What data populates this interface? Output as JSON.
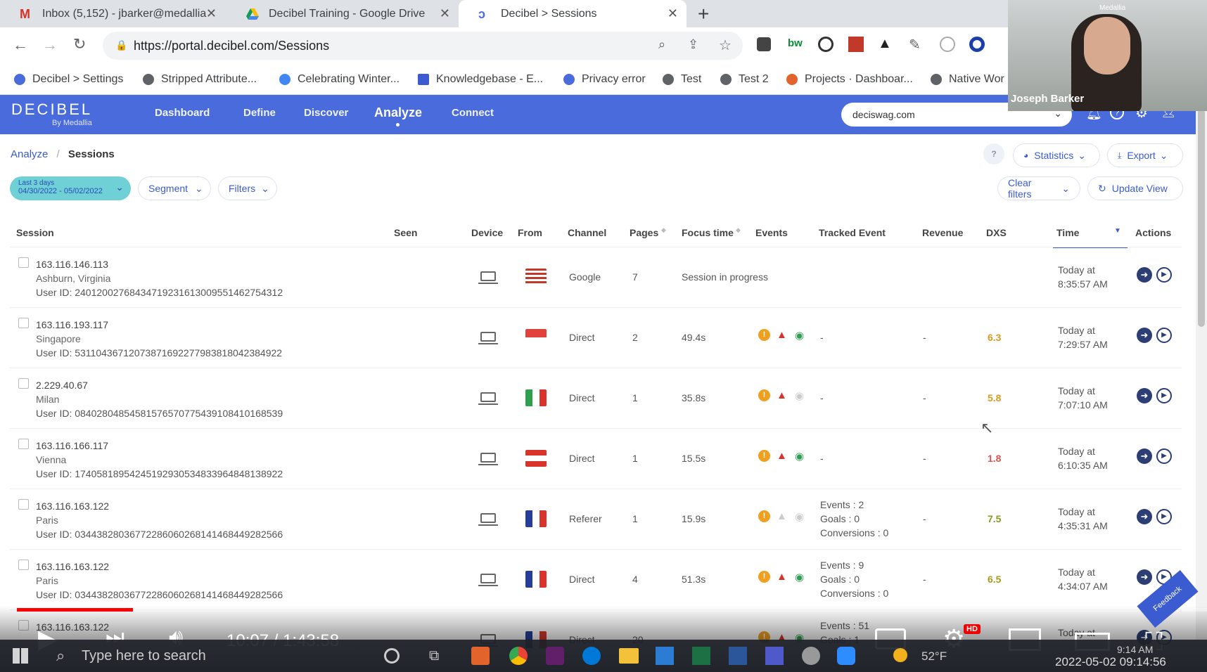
{
  "browser": {
    "tabs": [
      {
        "title": "Inbox (5,152) - jbarker@medallia",
        "close": "✕"
      },
      {
        "title": "Decibel Training - Google Drive",
        "close": "✕"
      },
      {
        "title": "Decibel > Sessions",
        "close": "✕"
      }
    ],
    "new_tab": "+",
    "url": "https://portal.decibel.com/Sessions",
    "bookmarks": [
      "Decibel > Settings",
      "Stripped Attribute...",
      "Celebrating Winter...",
      "Knowledgebase - E...",
      "Privacy error",
      "Test",
      "Test 2",
      "Projects · Dashboar...",
      "Native Wor"
    ]
  },
  "webcam": {
    "name": "Joseph Barker",
    "watermark": "Medallia"
  },
  "app": {
    "logo": "DECIBEL",
    "logo_sub": "By Medallia",
    "nav": [
      "Dashboard",
      "Define",
      "Discover",
      "Analyze",
      "Connect"
    ],
    "active_nav": "Analyze",
    "site": "deciswag.com",
    "accent": "#4a6bdc"
  },
  "breadcrumb": {
    "parent": "Analyze",
    "sep": "/",
    "current": "Sessions"
  },
  "toolbar": {
    "help": "?",
    "statistics": "Statistics",
    "export": "Export",
    "date_label": "Last 3 days",
    "date_range": "04/30/2022 - 05/02/2022",
    "segment": "Segment",
    "filters": "Filters",
    "clear_filters": "Clear filters",
    "update_view": "Update View"
  },
  "table": {
    "headers": [
      "Session",
      "Seen",
      "Device",
      "From",
      "Channel",
      "Pages",
      "Focus time",
      "Events",
      "Tracked Event",
      "Revenue",
      "DXS",
      "Time",
      "Actions"
    ],
    "rows": [
      {
        "ip": "163.116.146.113",
        "city": "Ashburn, Virginia",
        "user": "User ID: 24012002768434719231613009551462754312",
        "flag": "us",
        "channel": "Google",
        "pages": "7",
        "focus": "Session in progress",
        "events": [],
        "tracked": [],
        "revenue": "",
        "dxs": "",
        "dxs_color": "",
        "time1": "Today at",
        "time2": "8:35:57 AM"
      },
      {
        "ip": "163.116.193.117",
        "city": "Singapore",
        "user": "User ID: 53110436712073871692277983818042384922",
        "flag": "sg",
        "channel": "Direct",
        "pages": "2",
        "focus": "49.4s",
        "events": [
          "warn",
          "alert",
          "eye"
        ],
        "tracked": [
          "-"
        ],
        "revenue": "-",
        "dxs": "6.3",
        "dxs_color": "#d99a1e",
        "time1": "Today at",
        "time2": "7:29:57 AM"
      },
      {
        "ip": "2.229.40.67",
        "city": "Milan",
        "user": "User ID: 08402804854581576570775439108410168539",
        "flag": "it",
        "channel": "Direct",
        "pages": "1",
        "focus": "35.8s",
        "events": [
          "warn",
          "alert",
          "eye-off"
        ],
        "tracked": [
          "-"
        ],
        "revenue": "-",
        "dxs": "5.8",
        "dxs_color": "#d99a1e",
        "time1": "Today at",
        "time2": "7:07:10 AM"
      },
      {
        "ip": "163.116.166.117",
        "city": "Vienna",
        "user": "User ID: 17405818954245192930534833964848138922",
        "flag": "at",
        "channel": "Direct",
        "pages": "1",
        "focus": "15.5s",
        "events": [
          "warn",
          "alert",
          "eye"
        ],
        "tracked": [
          "-"
        ],
        "revenue": "-",
        "dxs": "1.8",
        "dxs_color": "#d9534f",
        "time1": "Today at",
        "time2": "6:10:35 AM"
      },
      {
        "ip": "163.116.163.122",
        "city": "Paris",
        "user": "User ID: 03443828036772286060268141468449282566",
        "flag": "fr",
        "channel": "Referer",
        "pages": "1",
        "focus": "15.9s",
        "events": [
          "warn",
          "alert-off",
          "eye-off"
        ],
        "tracked": [
          "Events : 2",
          "Goals : 0",
          "Conversions : 0"
        ],
        "revenue": "-",
        "dxs": "7.5",
        "dxs_color": "#8a9a1e",
        "time1": "Today at",
        "time2": "4:35:31 AM"
      },
      {
        "ip": "163.116.163.122",
        "city": "Paris",
        "user": "User ID: 03443828036772286060268141468449282566",
        "flag": "fr",
        "channel": "Direct",
        "pages": "4",
        "focus": "51.3s",
        "events": [
          "warn",
          "alert",
          "eye"
        ],
        "tracked": [
          "Events : 9",
          "Goals : 0",
          "Conversions : 0"
        ],
        "revenue": "-",
        "dxs": "6.5",
        "dxs_color": "#a99a1e",
        "time1": "Today at",
        "time2": "4:34:07 AM"
      },
      {
        "ip": "163.116.163.122",
        "city": "",
        "user": "",
        "flag": "fr",
        "channel": "Direct",
        "pages": "20",
        "focus": "",
        "events": [
          "warn",
          "alert",
          "eye"
        ],
        "tracked": [
          "Events : 51",
          "Goals : 1"
        ],
        "revenue": "",
        "dxs": "",
        "dxs_color": "#d99a1e",
        "time1": "Today at",
        "time2": ""
      }
    ]
  },
  "player": {
    "time": "10:07 / 1:43:58",
    "progress": 0.097,
    "hd": "HD",
    "feedback": "Feedback"
  },
  "taskbar": {
    "search_placeholder": "Type here to search",
    "temp": "52°F",
    "clock": "9:14 AM",
    "datetime": "2022-05-02 09:14:56"
  }
}
